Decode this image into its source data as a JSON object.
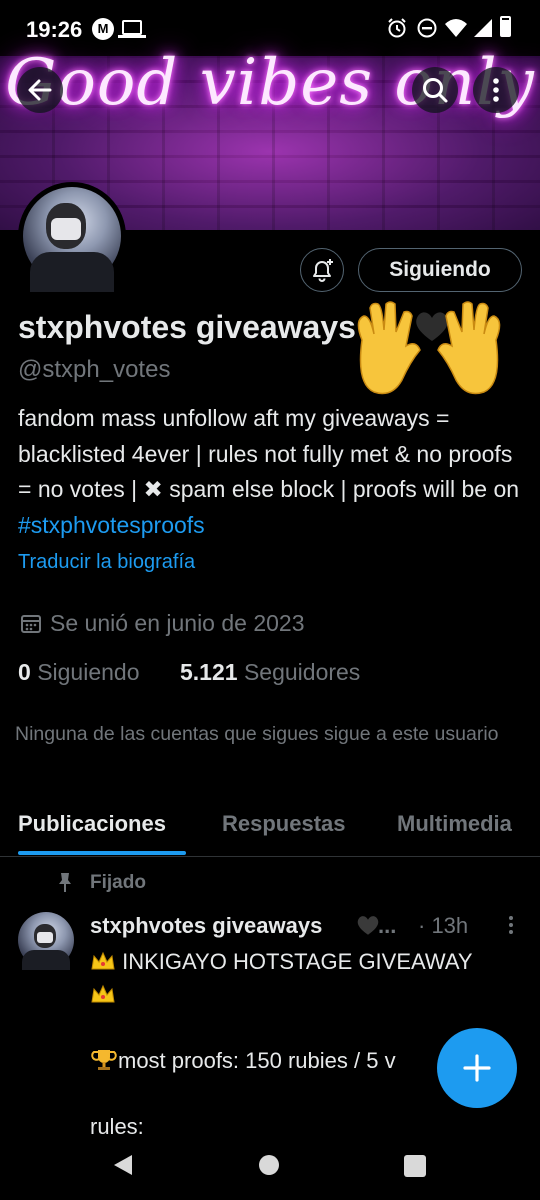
{
  "status_bar": {
    "time": "19:26",
    "moto_badge": "M",
    "icons": [
      "moto-icon",
      "laptop-icon",
      "alarm-icon",
      "dnd-icon",
      "wifi-icon",
      "signal-icon",
      "battery-icon"
    ]
  },
  "banner": {
    "neon_text": "Good vibes only",
    "colors": {
      "glow": "#e040fb",
      "brick": "#3b1e4d"
    }
  },
  "header_buttons": [
    "back-arrow-icon",
    "search-icon",
    "more-vertical-icon"
  ],
  "profile": {
    "display_name": "stxphvotes giveaways",
    "handle": "@stxph_votes",
    "follow_button_label": "Siguiendo",
    "bio": {
      "part1": "fandom mass unfollow aft my giveaways = blacklisted 4ever | rules not fully met & no proofs = no votes | ",
      "x_emoji": "✖",
      "part2": " spam else block | proofs will be on ",
      "hashtag": "#stxphvotesproofs"
    },
    "translate_label": "Traducir la biografía",
    "joined": "Se unió en junio de 2023",
    "following": {
      "count": "0",
      "label": "Siguiendo"
    },
    "followers": {
      "count": "5.121",
      "label": "Seguidores"
    },
    "mutuals_text": "Ninguna de las cuentas que sigues sigue a este usuario"
  },
  "tabs": [
    {
      "label": "Publicaciones",
      "active": true
    },
    {
      "label": "Respuestas",
      "active": false
    },
    {
      "label": "Multimedia",
      "active": false
    }
  ],
  "pinned_post": {
    "pinned_label": "Fijado",
    "author": "stxphvotes giveaways",
    "ellipsis": "...",
    "time": "· 13h",
    "line1": " INKIGAYO HOTSTAGE GIVEAWAY",
    "line3": "most proofs: 150 rubies / 5 v",
    "line5": "rules:"
  },
  "accent_color": "#1d9bf0"
}
